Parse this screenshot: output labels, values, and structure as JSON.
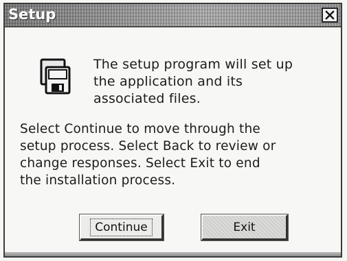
{
  "window": {
    "title": "Setup",
    "close_label": "X"
  },
  "intro": {
    "icon": "floppy-disks-icon",
    "text": "The setup program will set up\nthe application and its\nassociated files."
  },
  "body": {
    "text": "Select Continue to move through the\nsetup process. Select Back to review or\nchange responses. Select Exit to end\nthe installation process."
  },
  "buttons": {
    "continue_label": "Continue",
    "exit_label": "Exit"
  },
  "colors": {
    "titlebar": "#8a8a8a",
    "window_bg": "#f7f7f5",
    "text": "#1b1b1b"
  }
}
